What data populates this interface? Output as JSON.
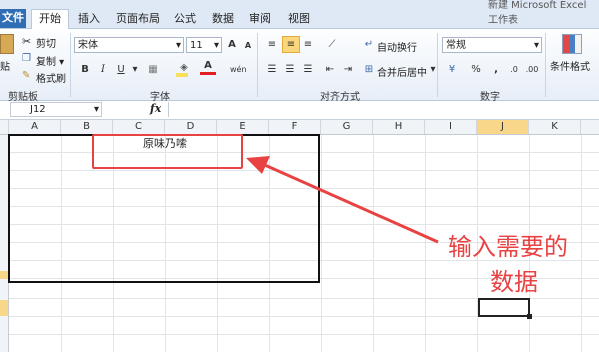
{
  "title_fragment": "新建 Microsoft Excel 工作表",
  "tabs": [
    "文件",
    "开始",
    "插入",
    "页面布局",
    "公式",
    "数据",
    "审阅",
    "视图"
  ],
  "clipboard": {
    "paste": "贴",
    "cut": "剪切",
    "copy": "复制 ▾",
    "format_painter": "格式刷",
    "label": "剪贴板"
  },
  "font": {
    "name": "宋体",
    "size": "11",
    "grow": "A",
    "shrink": "A",
    "bold": "B",
    "italic": "I",
    "underline": "U",
    "phonetic": "wén",
    "label": "字体"
  },
  "alignment": {
    "wrap": "自动换行",
    "merge": "合并后居中",
    "label": "对齐方式"
  },
  "number": {
    "format": "常规",
    "percent": "%",
    "comma": ",",
    "label": "数字"
  },
  "styles": {
    "conditional": "条件格式"
  },
  "formula_bar": {
    "name_box": "J12",
    "fx": "fx"
  },
  "columns": [
    "A",
    "B",
    "C",
    "D",
    "E",
    "F",
    "G",
    "H",
    "I",
    "J",
    "K"
  ],
  "cell_text": "原味乃嗦",
  "annotation": [
    "输入需要的",
    "数据"
  ],
  "colors": {
    "accent": "#e84242",
    "file_tab": "#2f6db5",
    "ribbon": "#e7eef7"
  }
}
